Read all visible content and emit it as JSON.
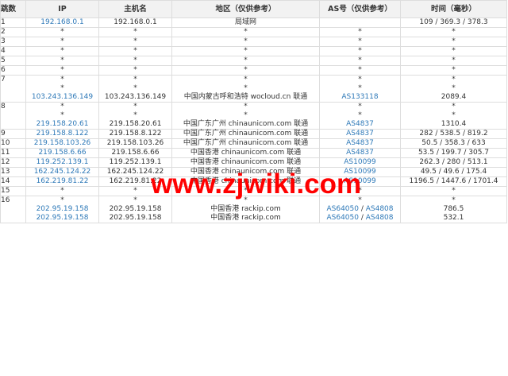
{
  "headers": {
    "hop": "跳数",
    "ip": "IP",
    "host": "主机名",
    "region": "地区（仅供参考）",
    "as": "AS号（仅供参考）",
    "time": "时间（毫秒）"
  },
  "rows": [
    {
      "hop": "1",
      "lines": [
        {
          "ip": "192.168.0.1",
          "host": "192.168.0.1",
          "region": "局域网",
          "as": [],
          "time": "109 / 369.3 / 378.3"
        }
      ]
    },
    {
      "hop": "2",
      "lines": [
        {
          "ip": "*",
          "host": "*",
          "region": "*",
          "as": [
            "*"
          ],
          "time": "*"
        }
      ]
    },
    {
      "hop": "3",
      "lines": [
        {
          "ip": "*",
          "host": "*",
          "region": "*",
          "as": [
            "*"
          ],
          "time": "*"
        }
      ]
    },
    {
      "hop": "4",
      "lines": [
        {
          "ip": "*",
          "host": "*",
          "region": "*",
          "as": [
            "*"
          ],
          "time": "*"
        }
      ]
    },
    {
      "hop": "5",
      "lines": [
        {
          "ip": "*",
          "host": "*",
          "region": "*",
          "as": [
            "*"
          ],
          "time": "*"
        }
      ]
    },
    {
      "hop": "6",
      "lines": [
        {
          "ip": "*",
          "host": "*",
          "region": "*",
          "as": [
            "*"
          ],
          "time": "*"
        }
      ]
    },
    {
      "hop": "7",
      "lines": [
        {
          "ip": "*",
          "host": "*",
          "region": "*",
          "as": [
            "*"
          ],
          "time": "*"
        },
        {
          "ip": "*",
          "host": "*",
          "region": "*",
          "as": [
            "*"
          ],
          "time": "*"
        },
        {
          "ip": "103.243.136.149",
          "host": "103.243.136.149",
          "region": "中国内蒙古呼和浩特 wocloud.cn 联通",
          "as": [
            "AS133118"
          ],
          "time": "2089.4"
        }
      ]
    },
    {
      "hop": "8",
      "lines": [
        {
          "ip": "*",
          "host": "*",
          "region": "*",
          "as": [
            "*"
          ],
          "time": "*"
        },
        {
          "ip": "*",
          "host": "*",
          "region": "*",
          "as": [
            "*"
          ],
          "time": "*"
        },
        {
          "ip": "219.158.20.61",
          "host": "219.158.20.61",
          "region": "中国广东广州 chinaunicom.com 联通",
          "as": [
            "AS4837"
          ],
          "time": "1310.4"
        }
      ]
    },
    {
      "hop": "9",
      "lines": [
        {
          "ip": "219.158.8.122",
          "host": "219.158.8.122",
          "region": "中国广东广州 chinaunicom.com 联通",
          "as": [
            "AS4837"
          ],
          "time": "282 / 538.5 / 819.2"
        }
      ]
    },
    {
      "hop": "10",
      "lines": [
        {
          "ip": "219.158.103.26",
          "host": "219.158.103.26",
          "region": "中国广东广州 chinaunicom.com 联通",
          "as": [
            "AS4837"
          ],
          "time": "50.5 / 358.3 / 633"
        }
      ]
    },
    {
      "hop": "11",
      "lines": [
        {
          "ip": "219.158.6.66",
          "host": "219.158.6.66",
          "region": "中国香港 chinaunicom.com 联通",
          "as": [
            "AS4837"
          ],
          "time": "53.5 / 199.7 / 305.7"
        }
      ]
    },
    {
      "hop": "12",
      "lines": [
        {
          "ip": "119.252.139.1",
          "host": "119.252.139.1",
          "region": "中国香港 chinaunicom.com 联通",
          "as": [
            "AS10099"
          ],
          "time": "262.3 / 280 / 513.1"
        }
      ]
    },
    {
      "hop": "13",
      "lines": [
        {
          "ip": "162.245.124.22",
          "host": "162.245.124.22",
          "region": "中国香港 chinaunicom.com 联通",
          "as": [
            "AS10099"
          ],
          "time": "49.5 / 49.6 / 175.4"
        }
      ]
    },
    {
      "hop": "14",
      "lines": [
        {
          "ip": "162.219.81.22",
          "host": "162.219.81.22",
          "region": "中国香港 chinaunicom.com 联通",
          "as": [
            "AS10099"
          ],
          "time": "1196.5 / 1447.6 / 1701.4"
        }
      ]
    },
    {
      "hop": "15",
      "lines": [
        {
          "ip": "*",
          "host": "*",
          "region": "*",
          "as": [
            "*"
          ],
          "time": "*"
        }
      ]
    },
    {
      "hop": "16",
      "lines": [
        {
          "ip": "*",
          "host": "*",
          "region": "*",
          "as": [
            "*"
          ],
          "time": "*"
        },
        {
          "ip": "202.95.19.158",
          "host": "202.95.19.158",
          "region": "中国香港 rackip.com",
          "as": [
            "AS64050",
            "AS4808"
          ],
          "time": "786.5"
        },
        {
          "ip": "202.95.19.158",
          "host": "202.95.19.158",
          "region": "中国香港 rackip.com",
          "as": [
            "AS64050",
            "AS4808"
          ],
          "time": "532.1"
        }
      ]
    }
  ],
  "as_separator": " / ",
  "watermark": "www.zjwiki.com",
  "colors": {
    "link": "#2e79b8",
    "header_bg": "#f2f2f2",
    "border": "#dddddd",
    "watermark": "#ff0000"
  }
}
